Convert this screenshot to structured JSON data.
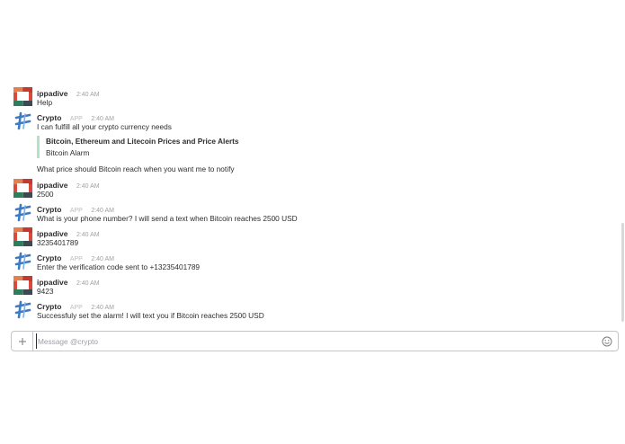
{
  "messages": [
    {
      "sender": "ippadive",
      "time": "2:40 AM",
      "text": "Help"
    },
    {
      "sender": "Crypto",
      "app_tag": "APP",
      "time": "2:40 AM",
      "text": "I can fulfill all your crypto currency needs",
      "attachment": {
        "title": "Bitcoin, Ethereum and Litecoin Prices and Price Alerts",
        "subtitle": "Bitcoin Alarm"
      },
      "followup": "What price should Bitcoin reach when you want me to notify"
    },
    {
      "sender": "ippadive",
      "time": "2:40 AM",
      "text": "2500"
    },
    {
      "sender": "Crypto",
      "app_tag": "APP",
      "time": "2:40 AM",
      "text": "What is your phone number? I will send a text when Bitcoin reaches 2500 USD"
    },
    {
      "sender": "ippadive",
      "time": "2:40 AM",
      "text": "3235401789"
    },
    {
      "sender": "Crypto",
      "app_tag": "APP",
      "time": "2:40 AM",
      "text": "Enter the verification code sent to +13235401789"
    },
    {
      "sender": "ippadive",
      "time": "2:40 AM",
      "text": "9423"
    },
    {
      "sender": "Crypto",
      "app_tag": "APP",
      "time": "2:40 AM",
      "text": "Successfuly set the alarm! I will text you if Bitcoin reaches 2500 USD"
    }
  ],
  "composer": {
    "placeholder": "Message @crypto",
    "plus_icon": "plus-icon",
    "emoji_icon": "smiley-icon"
  },
  "colors": {
    "attachment_bar": "#b7e1c4",
    "user_avatar_red": "#d9493c",
    "user_avatar_green": "#2f7d5b",
    "bot_avatar_blue": "#3b7cc4"
  }
}
